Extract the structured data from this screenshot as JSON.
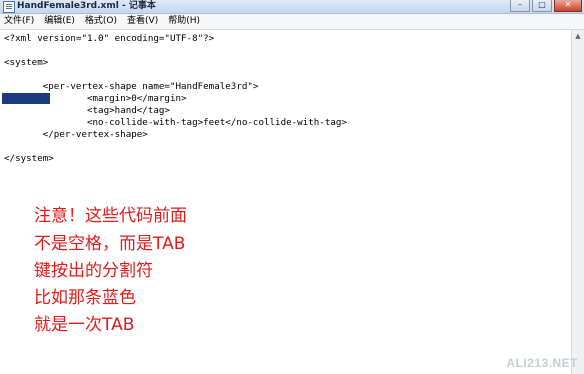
{
  "window": {
    "title": "HandFemale3rd.xml - 记事本",
    "minimize_glyph": "–",
    "maximize_glyph": "□",
    "close_glyph": "✕"
  },
  "menu": {
    "items": [
      "文件(F)",
      "编辑(E)",
      "格式(O)",
      "查看(V)",
      "帮助(H)"
    ]
  },
  "editor": {
    "lines": [
      "<?xml version=\"1.0\" encoding=\"UTF-8\"?>",
      "",
      "<system>",
      "",
      "       <per-vertex-shape name=\"HandFemale3rd\">",
      "               <margin>0</margin>",
      "               <tag>hand</tag>",
      "               <no-collide-with-tag>feet</no-collide-with-tag>",
      "       </per-vertex-shape>",
      "",
      "</system>"
    ]
  },
  "annotation": {
    "lines": [
      "注意！这些代码前面",
      "不是空格，而是TAB",
      "键按出的分割符",
      "比如那条蓝色",
      "就是一次TAB"
    ],
    "color": "#e31b1b"
  },
  "highlight_color": "#1e3a80",
  "watermark": "ALI213.NET"
}
